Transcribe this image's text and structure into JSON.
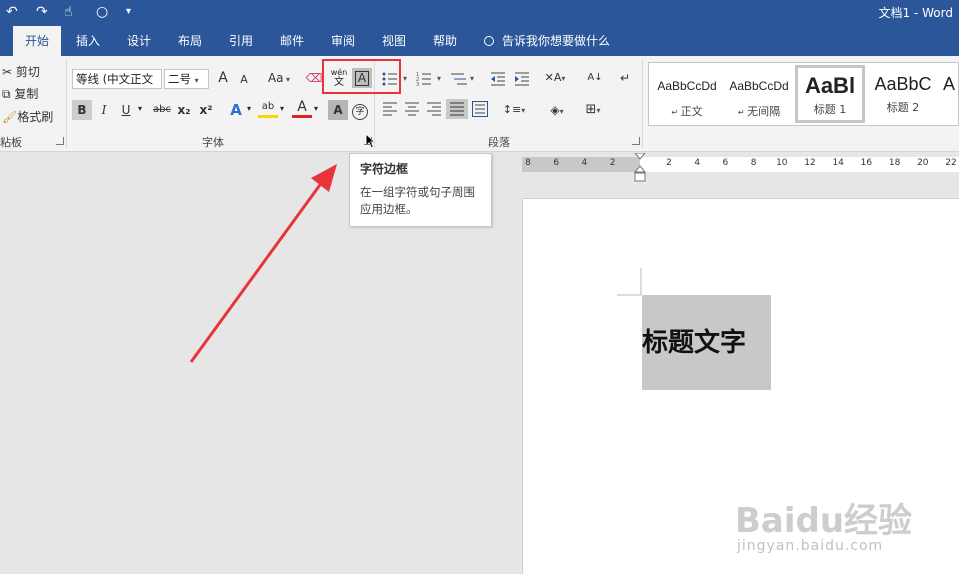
{
  "titlebar": {
    "title": "文档1 - Word",
    "qa": [
      "undo-icon",
      "redo-icon",
      "touch-mode-icon",
      "circle-icon",
      "customize-icon"
    ]
  },
  "tabs": [
    "开始",
    "插入",
    "设计",
    "布局",
    "引用",
    "邮件",
    "审阅",
    "视图",
    "帮助"
  ],
  "active_tab": "开始",
  "tell_me": "告诉我你想要做什么",
  "clipboard": {
    "cut": "剪切",
    "copy": "复制",
    "painter": "格式刷",
    "label": "粘板"
  },
  "font": {
    "label": "字体",
    "name": "等线 (中文正文",
    "size": "二号",
    "grow": "A",
    "shrink": "A",
    "case": "Aa",
    "phonetic_top": "wén",
    "phonetic_bottom": "文",
    "char_border": "A",
    "bold": "B",
    "italic": "I",
    "underline": "U",
    "strike": "abc",
    "sub": "x₂",
    "sup": "x²",
    "effects": "A",
    "font_color": "A",
    "shading": "A",
    "enclose": "字",
    "highlight": "ab"
  },
  "paragraph": {
    "label": "段落"
  },
  "styles": [
    {
      "preview": "AaBbCcDd",
      "name": "正文"
    },
    {
      "preview": "AaBbCcDd",
      "name": "无间隔"
    },
    {
      "preview": "AaBl",
      "name": "标题 1"
    },
    {
      "preview": "AaBbC",
      "name": "标题 2"
    },
    {
      "preview": "A",
      "name": ""
    }
  ],
  "tooltip": {
    "title": "字符边框",
    "body": "在一组字符或句子周围应用边框。"
  },
  "ruler": [
    "8",
    "6",
    "4",
    "2",
    "",
    "2",
    "4",
    "6",
    "8",
    "10",
    "12",
    "14",
    "16",
    "18",
    "20",
    "22"
  ],
  "document": {
    "heading": "标题文字"
  },
  "watermark": {
    "logo": "Baidu经验",
    "url": "jingyan.baidu.com"
  },
  "colors": {
    "accent": "#2b579a",
    "highlight_box": "#e8333a",
    "arrow": "#e8333a",
    "selection": "#c8c8c8"
  }
}
